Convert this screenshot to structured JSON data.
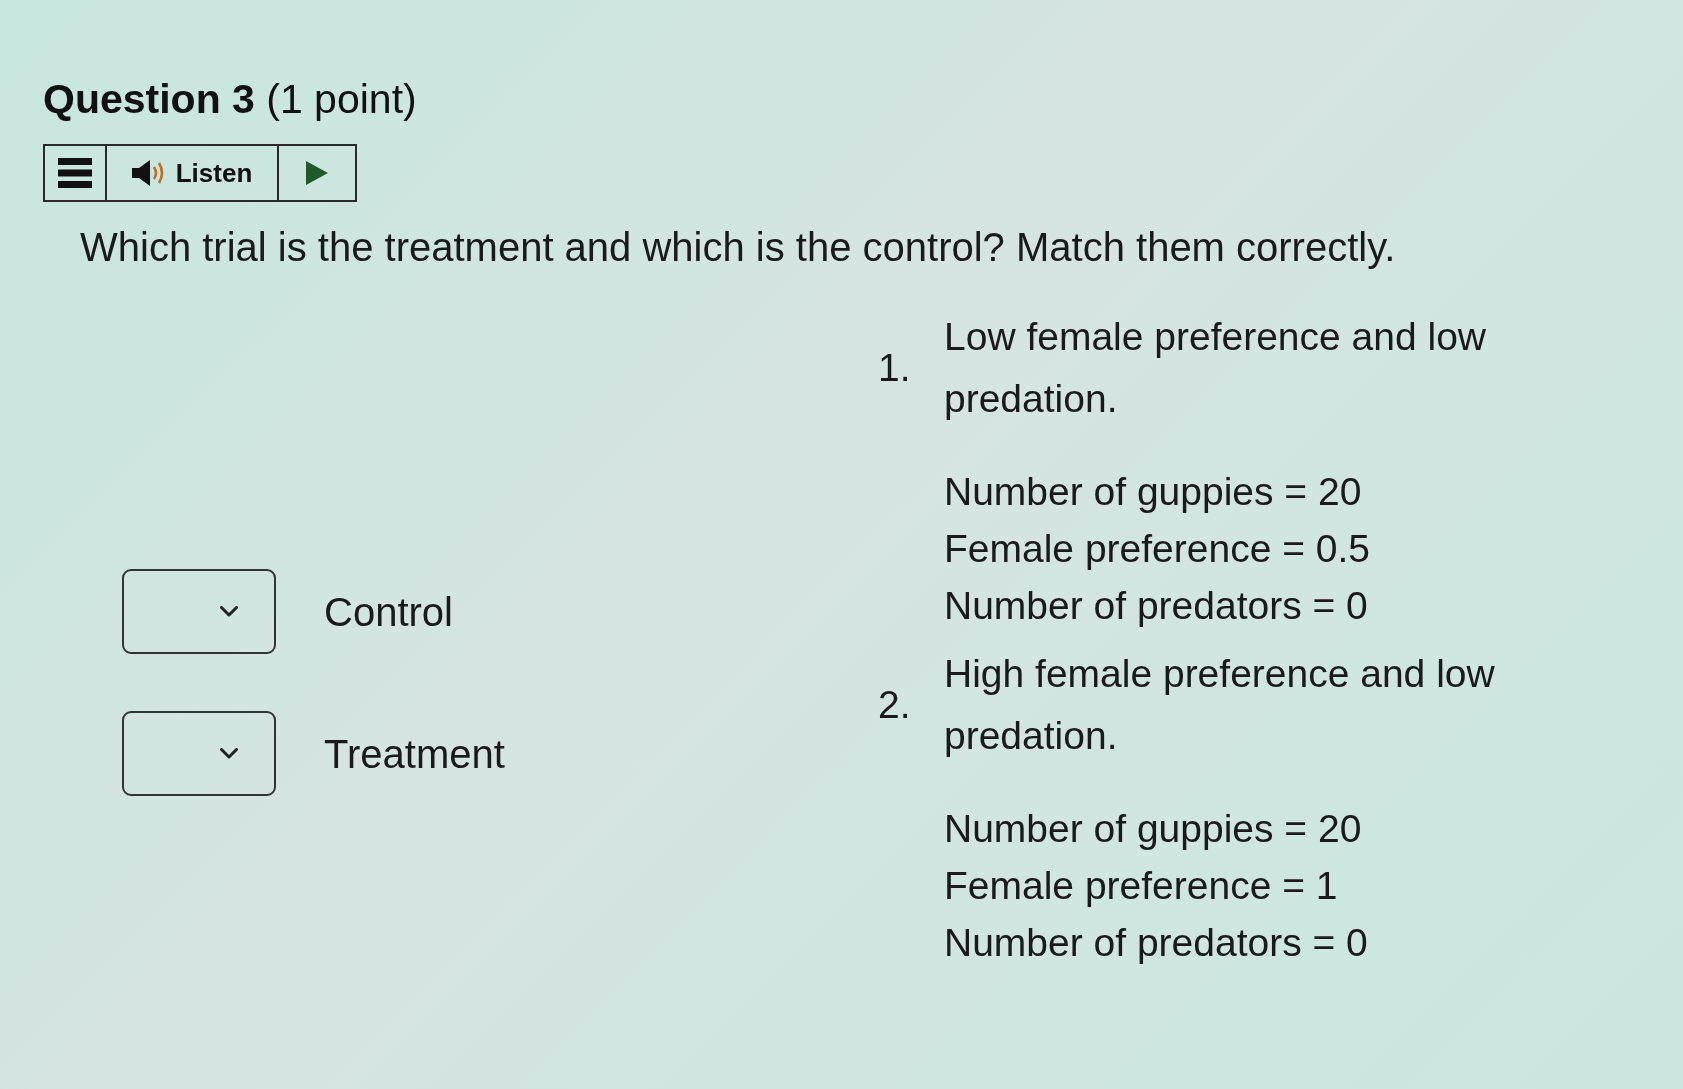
{
  "question": {
    "title": "**Question 3** (1 point)",
    "prompt": "Which trial is the treatment and which is the control? Match them correctly."
  },
  "toolbar": {
    "listen_label": "Listen"
  },
  "matches": [
    {
      "label": "Control"
    },
    {
      "label": "Treatment"
    }
  ],
  "options": [
    {
      "number": "1.",
      "description": "Low female preference and low predation.",
      "details": [
        "Number of guppies = 20",
        "Female preference = 0.5",
        "Number of predators = 0"
      ]
    },
    {
      "number": "2.",
      "description": "High female preference and low predation.",
      "details": [
        "Number of guppies = 20",
        "Female preference = 1",
        "Number of predators = 0"
      ]
    }
  ]
}
